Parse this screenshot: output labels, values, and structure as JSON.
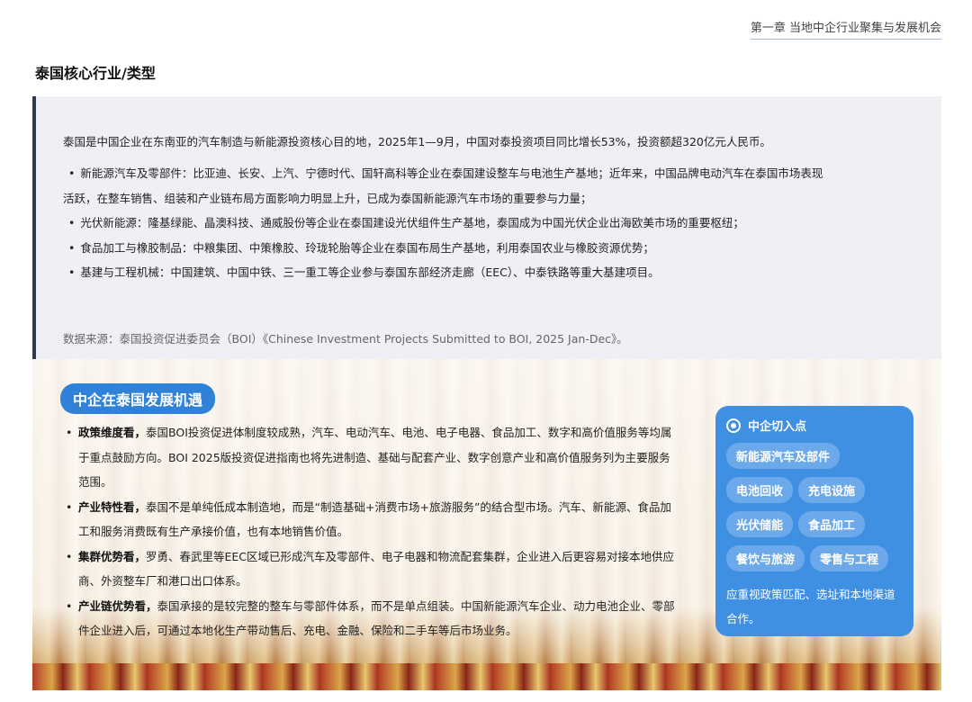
{
  "header": {
    "chapter": "第一章 当地中企行业聚集与发展机会",
    "page_title": "泰国核心行业/类型"
  },
  "industry_box": {
    "intro": "泰国是中国企业在东南亚的汽车制造与新能源投资核心目的地，2025年1—9月，中国对泰投资项目同比增长53%，投资额超320亿元人民币。",
    "items": [
      "新能源汽车及零部件：比亚迪、长安、上汽、宁德时代、国轩高科等企业在泰国建设整车与电池生产基地；近年来，中国品牌电动汽车在泰国市场表现活跃，在整车销售、组装和产业链布局方面影响力明显上升，已成为泰国新能源汽车市场的重要参与力量；",
      "光伏新能源：隆基绿能、晶澳科技、通威股份等企业在泰国建设光伏组件生产基地，泰国成为中国光伏企业出海欧美市场的重要枢纽；",
      "食品加工与橡胶制品：中粮集团、中策橡胶、玲珑轮胎等企业在泰国布局生产基地，利用泰国农业与橡胶资源优势；",
      "基建与工程机械：中国建筑、中国中铁、三一重工等企业参与泰国东部经济走廊（EEC）、中泰铁路等重大基建项目。"
    ],
    "source": "数据来源：泰国投资促进委员会（BOI）《Chinese Investment Projects Submitted to BOI, 2025 Jan-Dec》。"
  },
  "opportunities": {
    "title": "中企在泰国发展机遇",
    "items": [
      {
        "bold": "政策维度看，",
        "text": "泰国BOI投资促进体制度较成熟，汽车、电动汽车、电池、电子电器、食品加工、数字和高价值服务等均属于重点鼓励方向。BOI 2025版投资促进指南也将先进制造、基础与配套产业、数字创意产业和高价值服务列为主要服务范围。"
      },
      {
        "bold": "产业特性看，",
        "text": "泰国不是单纯低成本制造地，而是“制造基础+消费市场+旅游服务”的结合型市场。汽车、新能源、食品加工和服务消费既有生产承接价值，也有本地销售价值。"
      },
      {
        "bold": "集群优势看，",
        "text": "罗勇、春武里等EEC区域已形成汽车及零部件、电子电器和物流配套集群，企业进入后更容易对接本地供应商、外资整车厂和港口出口体系。"
      },
      {
        "bold": "产业链优势看，",
        "text": "泰国承接的是较完整的整车与零部件体系，而不是单点组装。中国新能源汽车企业、动力电池企业、零部件企业进入后，可通过本地化生产带动售后、充电、金融、保险和二手车等后市场业务。"
      }
    ]
  },
  "entry_card": {
    "title": "中企切入点",
    "icon": "target-icon",
    "tags": [
      "新能源汽车及部件",
      "电池回收",
      "充电设施",
      "光伏储能",
      "食品加工",
      "餐饮与旅游",
      "零售与工程"
    ],
    "note": "应重视政策匹配、选址和本地渠道合作。"
  },
  "colors": {
    "accent": "#2f82d8",
    "card": "#3f8fe3",
    "box_bg": "#eef0f3",
    "box_border": "#2f3a4d"
  }
}
